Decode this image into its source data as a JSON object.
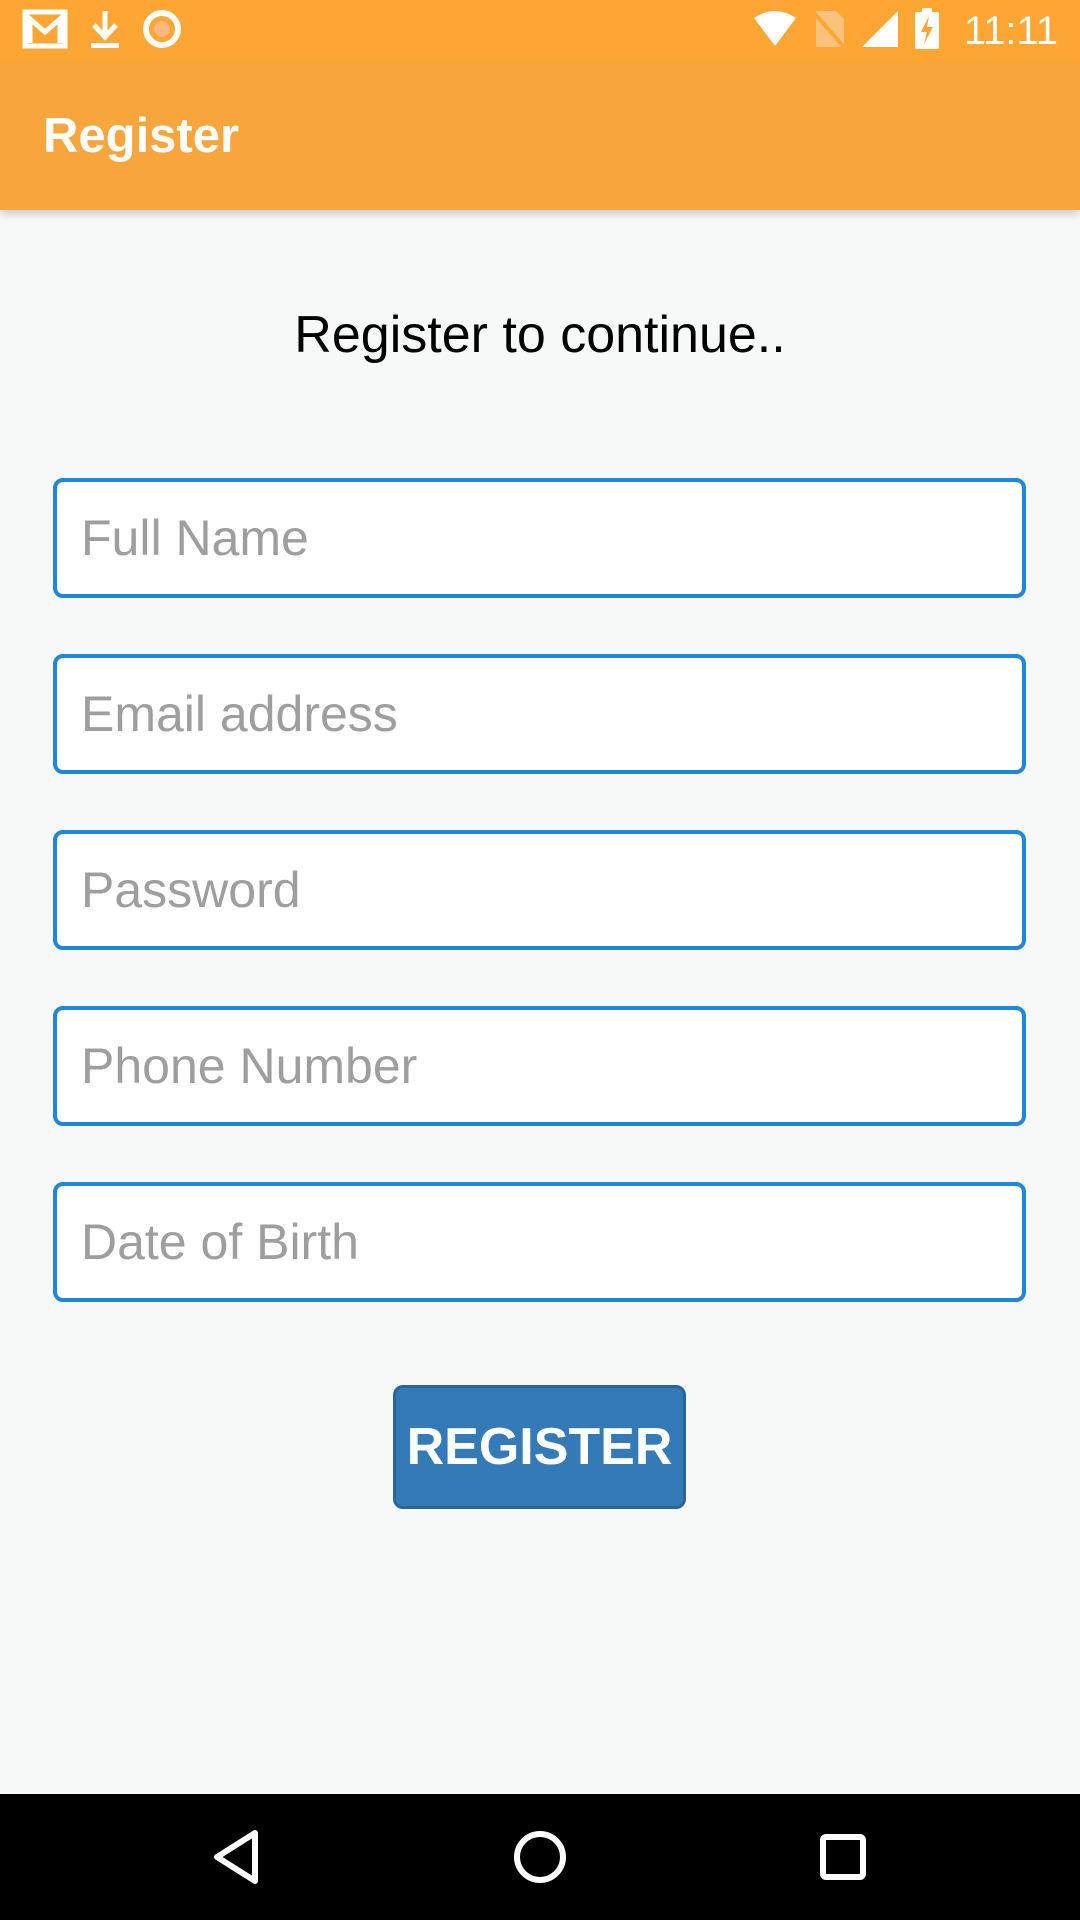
{
  "status_bar": {
    "time": "11:11",
    "icons": [
      "gmail-icon",
      "download-icon",
      "record-icon",
      "wifi-icon",
      "no-sim-icon",
      "signal-icon",
      "battery-charging-icon"
    ]
  },
  "app_bar": {
    "title": "Register",
    "color": "#f6a63c"
  },
  "form": {
    "heading": "Register to continue..",
    "fields": [
      {
        "placeholder": "Full Name",
        "value": ""
      },
      {
        "placeholder": "Email address",
        "value": ""
      },
      {
        "placeholder": "Password",
        "value": ""
      },
      {
        "placeholder": "Phone Number",
        "value": ""
      },
      {
        "placeholder": "Date of Birth",
        "value": ""
      }
    ],
    "field_border_color": "#1d88d9",
    "submit_label": "REGISTER",
    "submit_color": "#337ab7"
  },
  "nav_bar": {
    "icons": [
      "back-icon",
      "home-icon",
      "recents-icon"
    ]
  }
}
